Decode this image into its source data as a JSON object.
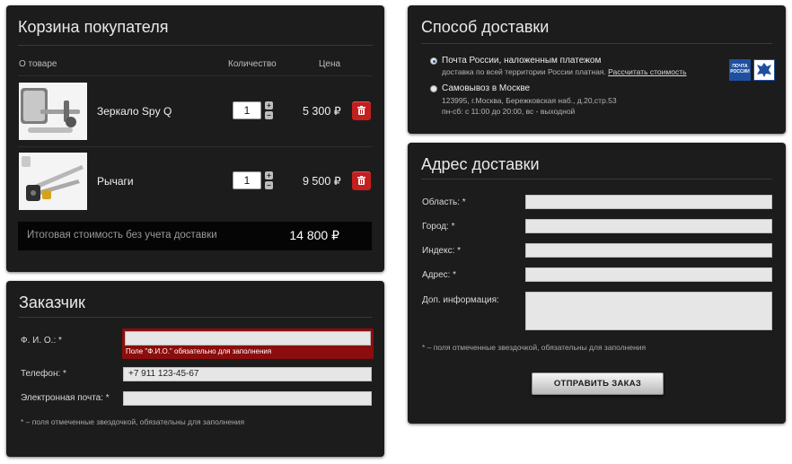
{
  "cart": {
    "title": "Корзина покупателя",
    "columns": {
      "item": "О товаре",
      "quantity": "Количество",
      "price": "Цена"
    },
    "items": [
      {
        "name": "Зеркало Spy Q",
        "quantity": "1",
        "price": "5 300 ₽"
      },
      {
        "name": "Рычаги",
        "quantity": "1",
        "price": "9 500 ₽"
      }
    ],
    "qty_plus": "+",
    "qty_minus": "−",
    "total_label": "Итоговая стоимость без учета доставки",
    "total_value": "14 800 ₽"
  },
  "customer": {
    "title": "Заказчик",
    "fields": [
      {
        "label": "Ф. И. О.: *",
        "value": "",
        "error": "Поле \"Ф.И.О.\" обязательно для заполнения"
      },
      {
        "label": "Телефон: *",
        "value": "+7 911 123-45-67"
      },
      {
        "label": "Электронная почта: *",
        "value": ""
      }
    ],
    "note": "* – поля отмеченные звездочкой, обязательны для заполнения"
  },
  "delivery": {
    "title": "Способ доставки",
    "options": [
      {
        "title": "Почта России, наложенным платежом",
        "desc": "доставка по всей территории России платная.",
        "link": "Рассчитать стоимость",
        "selected": true
      },
      {
        "title": "Самовывоз в Москве",
        "desc_line1": "123995, г.Москва, Бережковская наб., д.20,стр.53",
        "desc_line2": "пн-сб: с 11:00 до 20:00, вс - выходной",
        "selected": false
      }
    ],
    "logo_text_line1": "ПОЧТА",
    "logo_text_line2": "РОССИИ",
    "logo_color": "#1f4fa0"
  },
  "address": {
    "title": "Адрес доставки",
    "fields": [
      {
        "label": "Область: *"
      },
      {
        "label": "Город: *"
      },
      {
        "label": "Индекс: *"
      },
      {
        "label": "Адрес: *"
      },
      {
        "label": "Доп. информация:"
      }
    ],
    "note": "* – поля отмеченные звездочкой, обязательны для заполнения",
    "submit_label": "ОТПРАВИТЬ ЗАКАЗ"
  }
}
